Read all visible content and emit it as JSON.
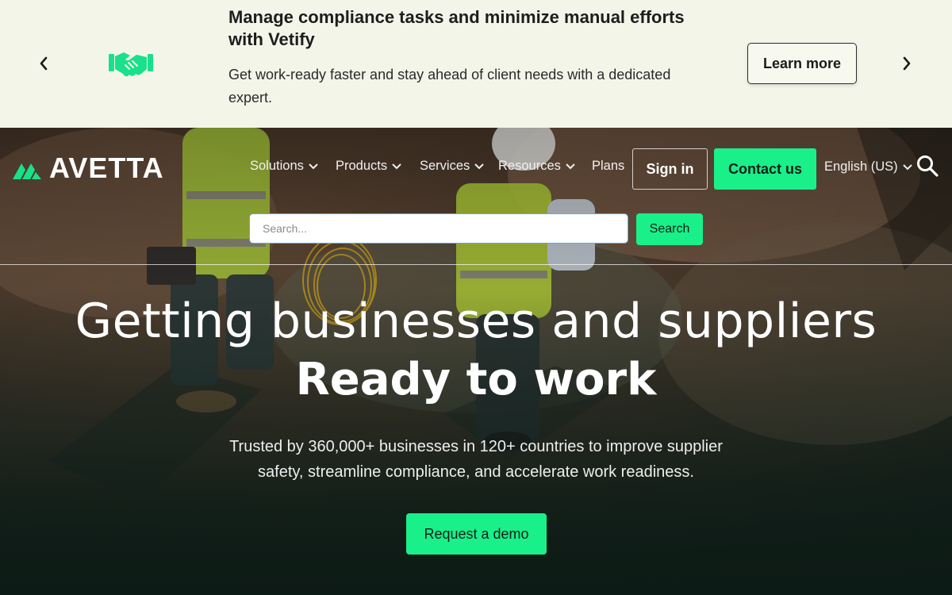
{
  "banner": {
    "title": "Manage compliance tasks and minimize manual efforts with Vetify",
    "subtitle": "Get work-ready faster and stay ahead of client needs with a dedicated expert.",
    "cta": "Learn more",
    "icon": "handshake-icon"
  },
  "brand": {
    "logo_text": "AVETTA",
    "accent": "#19f08a",
    "banner_bg": "#f4f5e9"
  },
  "nav": {
    "items": [
      {
        "label": "Solutions",
        "has_dropdown": true
      },
      {
        "label": "Products",
        "has_dropdown": true
      },
      {
        "label": "Services",
        "has_dropdown": true
      },
      {
        "label": "Resources",
        "has_dropdown": true
      },
      {
        "label": "Plans",
        "has_dropdown": false
      }
    ],
    "sign_in": "Sign in",
    "contact": "Contact us",
    "language": "English (US)"
  },
  "search": {
    "placeholder": "Search...",
    "button": "Search"
  },
  "hero": {
    "headline_line1": "Getting businesses and suppliers",
    "headline_line2": "Ready to work",
    "subtext": "Trusted by 360,000+ businesses in 120+ countries to improve supplier safety, streamline compliance, and accelerate work readiness.",
    "cta": "Request a demo"
  }
}
